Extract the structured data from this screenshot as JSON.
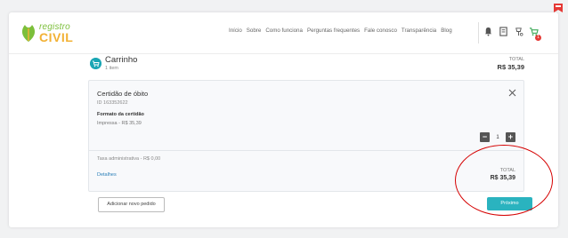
{
  "logo": {
    "line1": "registro",
    "line2": "CIVIL"
  },
  "nav": {
    "links": [
      "Início",
      "Sobre",
      "Como funciona",
      "Perguntas frequentes",
      "Fale conosco",
      "Transparência",
      "Blog"
    ],
    "icons": [
      "bell-icon",
      "document-icon",
      "pin-icon",
      "cart-icon"
    ],
    "cart_count": "1"
  },
  "cart": {
    "title": "Carrinho",
    "subtitle": "1 item",
    "total_label": "TOTAL",
    "total_value": "R$ 35,39"
  },
  "item": {
    "title": "Certidão de óbito",
    "id": "ID 163352622",
    "format_label": "Formato da certidão",
    "format_value": "Impressa - R$ 35,39",
    "quantity": "1",
    "minus": "−",
    "plus": "+",
    "fee": "Taxa administrativa - R$ 0,00",
    "details": "Detalhes",
    "total_label": "TOTAL",
    "total_value": "R$ 35,39"
  },
  "actions": {
    "add_order": "Adicionar novo pedido",
    "next": "Próximo"
  },
  "colors": {
    "accent": "#2ab3bf",
    "annotation": "#d50000",
    "badge": "#e53935",
    "link": "#2a7fb8"
  }
}
